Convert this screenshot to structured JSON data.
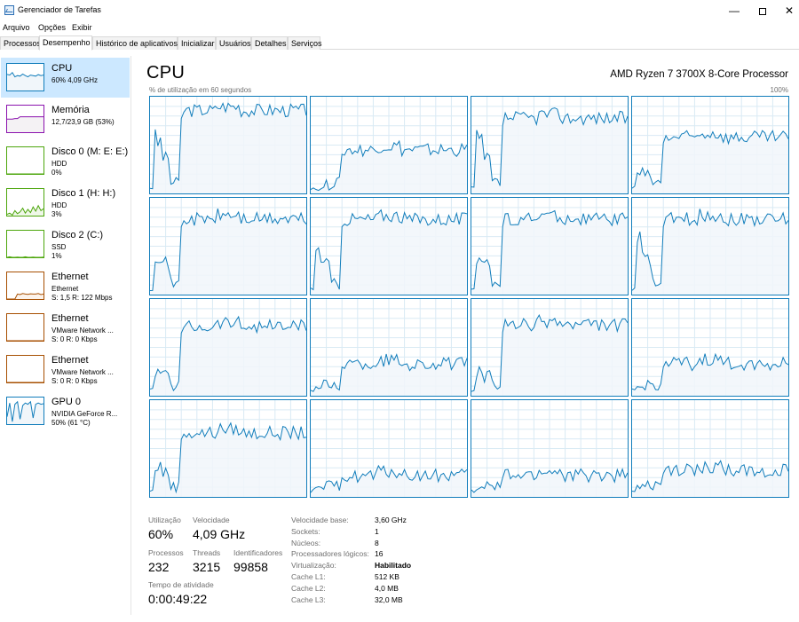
{
  "window": {
    "title": "Gerenciador de Tarefas",
    "minimize": "—",
    "close": "✕"
  },
  "menu": [
    "Arquivo",
    "Opções",
    "Exibir"
  ],
  "tabs": [
    "Processos",
    "Desempenho",
    "Histórico de aplicativos",
    "Inicializar",
    "Usuários",
    "Detalhes",
    "Serviços"
  ],
  "active_tab": "Desempenho",
  "sidebar": {
    "items": [
      {
        "name": "CPU",
        "line1": "60% 4,09 GHz",
        "line2": "",
        "color": "#117dbb",
        "fill": "#f1f6fa"
      },
      {
        "name": "Memória",
        "line1": "12,7/23,9 GB (53%)",
        "line2": "",
        "color": "#8b12ae",
        "fill": "#f4f2f4"
      },
      {
        "name": "Disco 0 (M: E: E:)",
        "line1": "HDD",
        "line2": "0%",
        "color": "#4da60c",
        "fill": "#eff7e8"
      },
      {
        "name": "Disco 1 (H: H:)",
        "line1": "HDD",
        "line2": "3%",
        "color": "#4da60c",
        "fill": "#eff7e8"
      },
      {
        "name": "Disco 2 (C:)",
        "line1": "SSD",
        "line2": "1%",
        "color": "#4da60c",
        "fill": "#eff7e8"
      },
      {
        "name": "Ethernet",
        "line1": "Ethernet",
        "line2": "S: 1,5 R: 122 Mbps",
        "color": "#a74f01",
        "fill": "#fcf3eb"
      },
      {
        "name": "Ethernet",
        "line1": "VMware Network ...",
        "line2": "S: 0 R: 0 Kbps",
        "color": "#a74f01",
        "fill": "#fcf3eb"
      },
      {
        "name": "Ethernet",
        "line1": "VMware Network ...",
        "line2": "S: 0 R: 0 Kbps",
        "color": "#a74f01",
        "fill": "#fcf3eb"
      },
      {
        "name": "GPU 0",
        "line1": "NVIDIA GeForce R...",
        "line2": "50% (61 °C)",
        "color": "#117dbb",
        "fill": "#f1f6fa"
      }
    ]
  },
  "main": {
    "title": "CPU",
    "model": "AMD Ryzen 7 3700X 8-Core Processor",
    "graph_caption": "% de utilização em 60 segundos",
    "graph_max": "100%",
    "core_count": 16,
    "line_color": "#117dbb",
    "fill_color": "#f1f6fa",
    "grid_color": "#d9eaf4"
  },
  "stats": {
    "utilizacao_label": "Utilização",
    "utilizacao_value": "60%",
    "velocidade_label": "Velocidade",
    "velocidade_value": "4,09 GHz",
    "processos_label": "Processos",
    "processos_value": "232",
    "threads_label": "Threads",
    "threads_value": "3215",
    "identificadores_label": "Identificadores",
    "identificadores_value": "99858",
    "tempo_label": "Tempo de atividade",
    "tempo_value": "0:00:49:22"
  },
  "details": [
    {
      "label": "Velocidade base:",
      "value": "3,60 GHz",
      "bold": false
    },
    {
      "label": "Sockets:",
      "value": "1",
      "bold": false
    },
    {
      "label": "Núcleos:",
      "value": "8",
      "bold": false
    },
    {
      "label": "Processadores lógicos:",
      "value": "16",
      "bold": false
    },
    {
      "label": "Virtualização:",
      "value": "Habilitado",
      "bold": true
    },
    {
      "label": "Cache L1:",
      "value": "512 KB",
      "bold": false
    },
    {
      "label": "Cache L2:",
      "value": "4,0 MB",
      "bold": false
    },
    {
      "label": "Cache L3:",
      "value": "32,0 MB",
      "bold": false
    }
  ]
}
